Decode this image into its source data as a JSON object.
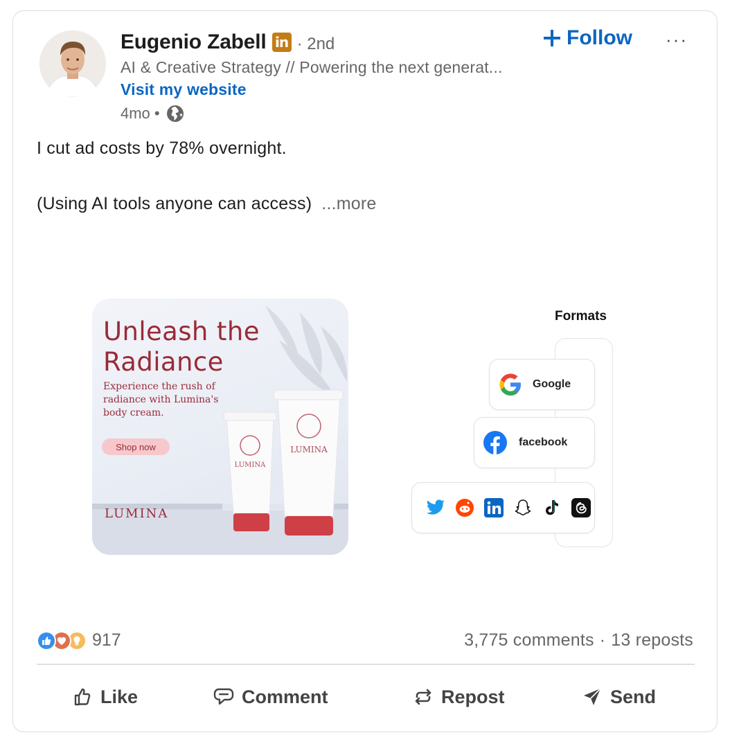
{
  "author": {
    "name": "Eugenio Zabell",
    "badge": "in",
    "degree": "· 2nd",
    "headline": "AI & Creative Strategy // Powering the next generat...",
    "website": "Visit my website",
    "time": "4mo •"
  },
  "actions_top": {
    "follow": "Follow",
    "more": "···"
  },
  "post": {
    "line1": "I cut ad costs by 78% overnight.",
    "line2": "(Using AI tools anyone can access)",
    "more": "...more"
  },
  "media": {
    "ad": {
      "headline_line1": "Unleash the",
      "headline_line2": "Radiance",
      "sub": "Experience the rush of radiance with Lumina's body cream.",
      "cta": "Shop now",
      "brand": "LUMINA",
      "tube_brand": "LUMINA"
    },
    "formats": {
      "title": "Formats",
      "google": "Google",
      "facebook": "facebook"
    }
  },
  "stats": {
    "reactions": "917",
    "comments": "3,775 comments",
    "separator": "·",
    "reposts": "13 reposts"
  },
  "action_bar": {
    "like": "Like",
    "comment": "Comment",
    "repost": "Repost",
    "send": "Send"
  },
  "colors": {
    "accent": "#0a66c2",
    "ad_red": "#9b2a37",
    "muted": "#666666"
  }
}
